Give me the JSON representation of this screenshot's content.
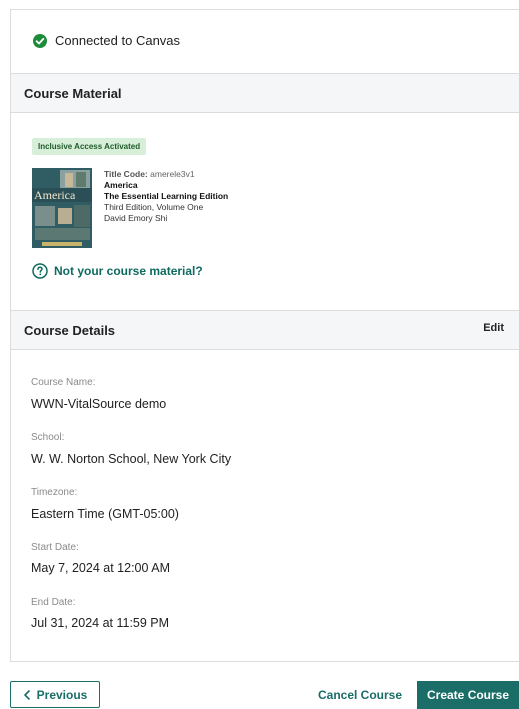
{
  "connection": {
    "status_text": "Connected to Canvas",
    "status_color": "#1e8b3b",
    "icon": "check-circle-icon"
  },
  "course_material": {
    "header": "Course Material",
    "badge": "Inclusive Access Activated",
    "book": {
      "title_code_label": "Title Code:",
      "title_code": "amerele3v1",
      "title": "America",
      "subtitle": "The Essential Learning Edition",
      "edition": "Third Edition, Volume One",
      "author": "David Emory Shi",
      "cover_title": "America"
    },
    "not_your_material": "Not your course material?"
  },
  "course_details": {
    "header": "Course Details",
    "edit_label": "Edit",
    "fields": [
      {
        "label": "Course Name:",
        "value": "WWN-VitalSource demo"
      },
      {
        "label": "School:",
        "value": "W. W. Norton School, New York City"
      },
      {
        "label": "Timezone:",
        "value": "Eastern Time (GMT-05:00)"
      },
      {
        "label": "Start Date:",
        "value": "May 7, 2024 at 12:00 AM"
      },
      {
        "label": "End Date:",
        "value": "Jul 31, 2024 at 11:59 PM"
      }
    ]
  },
  "footer": {
    "previous_label": "Previous",
    "cancel_label": "Cancel Course",
    "create_label": "Create Course"
  },
  "colors": {
    "accent": "#1b6d68",
    "badge_bg": "#d7efd8",
    "header_bg": "#f4f6f8"
  }
}
